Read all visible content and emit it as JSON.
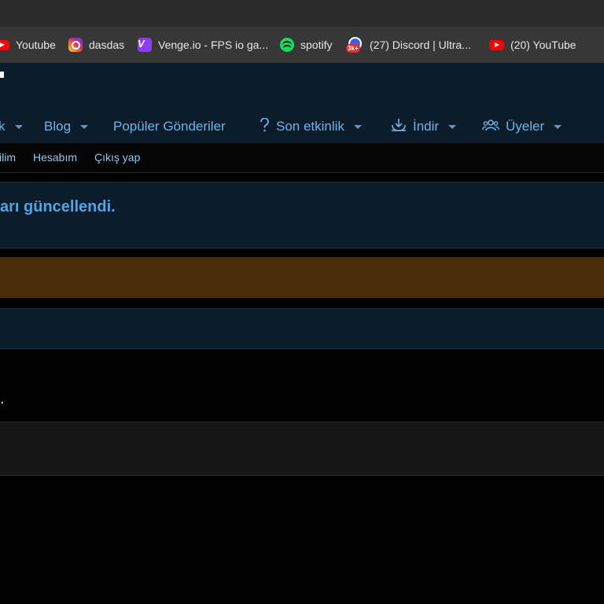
{
  "bookmarks": [
    {
      "label": "Youtube",
      "icon": "youtube-icon"
    },
    {
      "label": "dasdas",
      "icon": "instagram-icon"
    },
    {
      "label": "Venge.io - FPS io ga...",
      "icon": "venge-icon"
    },
    {
      "label": "spotify",
      "icon": "spotify-icon"
    },
    {
      "label": "(27) Discord | Ultra...",
      "icon": "discord-icon",
      "badge": "3k+"
    },
    {
      "label": "(20) YouTube",
      "icon": "youtube-icon"
    }
  ],
  "nav": {
    "items": [
      {
        "label": "k"
      },
      {
        "label": "Blog"
      },
      {
        "label": "Popüler Gönderiler"
      },
      {
        "label": "Son etkinlik",
        "icon": "question-icon"
      },
      {
        "label": "İndir",
        "icon": "download-icon"
      },
      {
        "label": "Üyeler",
        "icon": "users-icon"
      }
    ]
  },
  "subnav": {
    "items": [
      {
        "label": "ilim"
      },
      {
        "label": "Hesabım"
      },
      {
        "label": "Çıkış yap"
      }
    ]
  },
  "notice": {
    "message": "arı güncellendi."
  },
  "body": {
    "fragment": "."
  },
  "colors": {
    "header_bg": "#0c1c2b",
    "link": "#71b3e8",
    "notice_text": "#4fa5e6",
    "warning_bg": "#4a2d08"
  }
}
